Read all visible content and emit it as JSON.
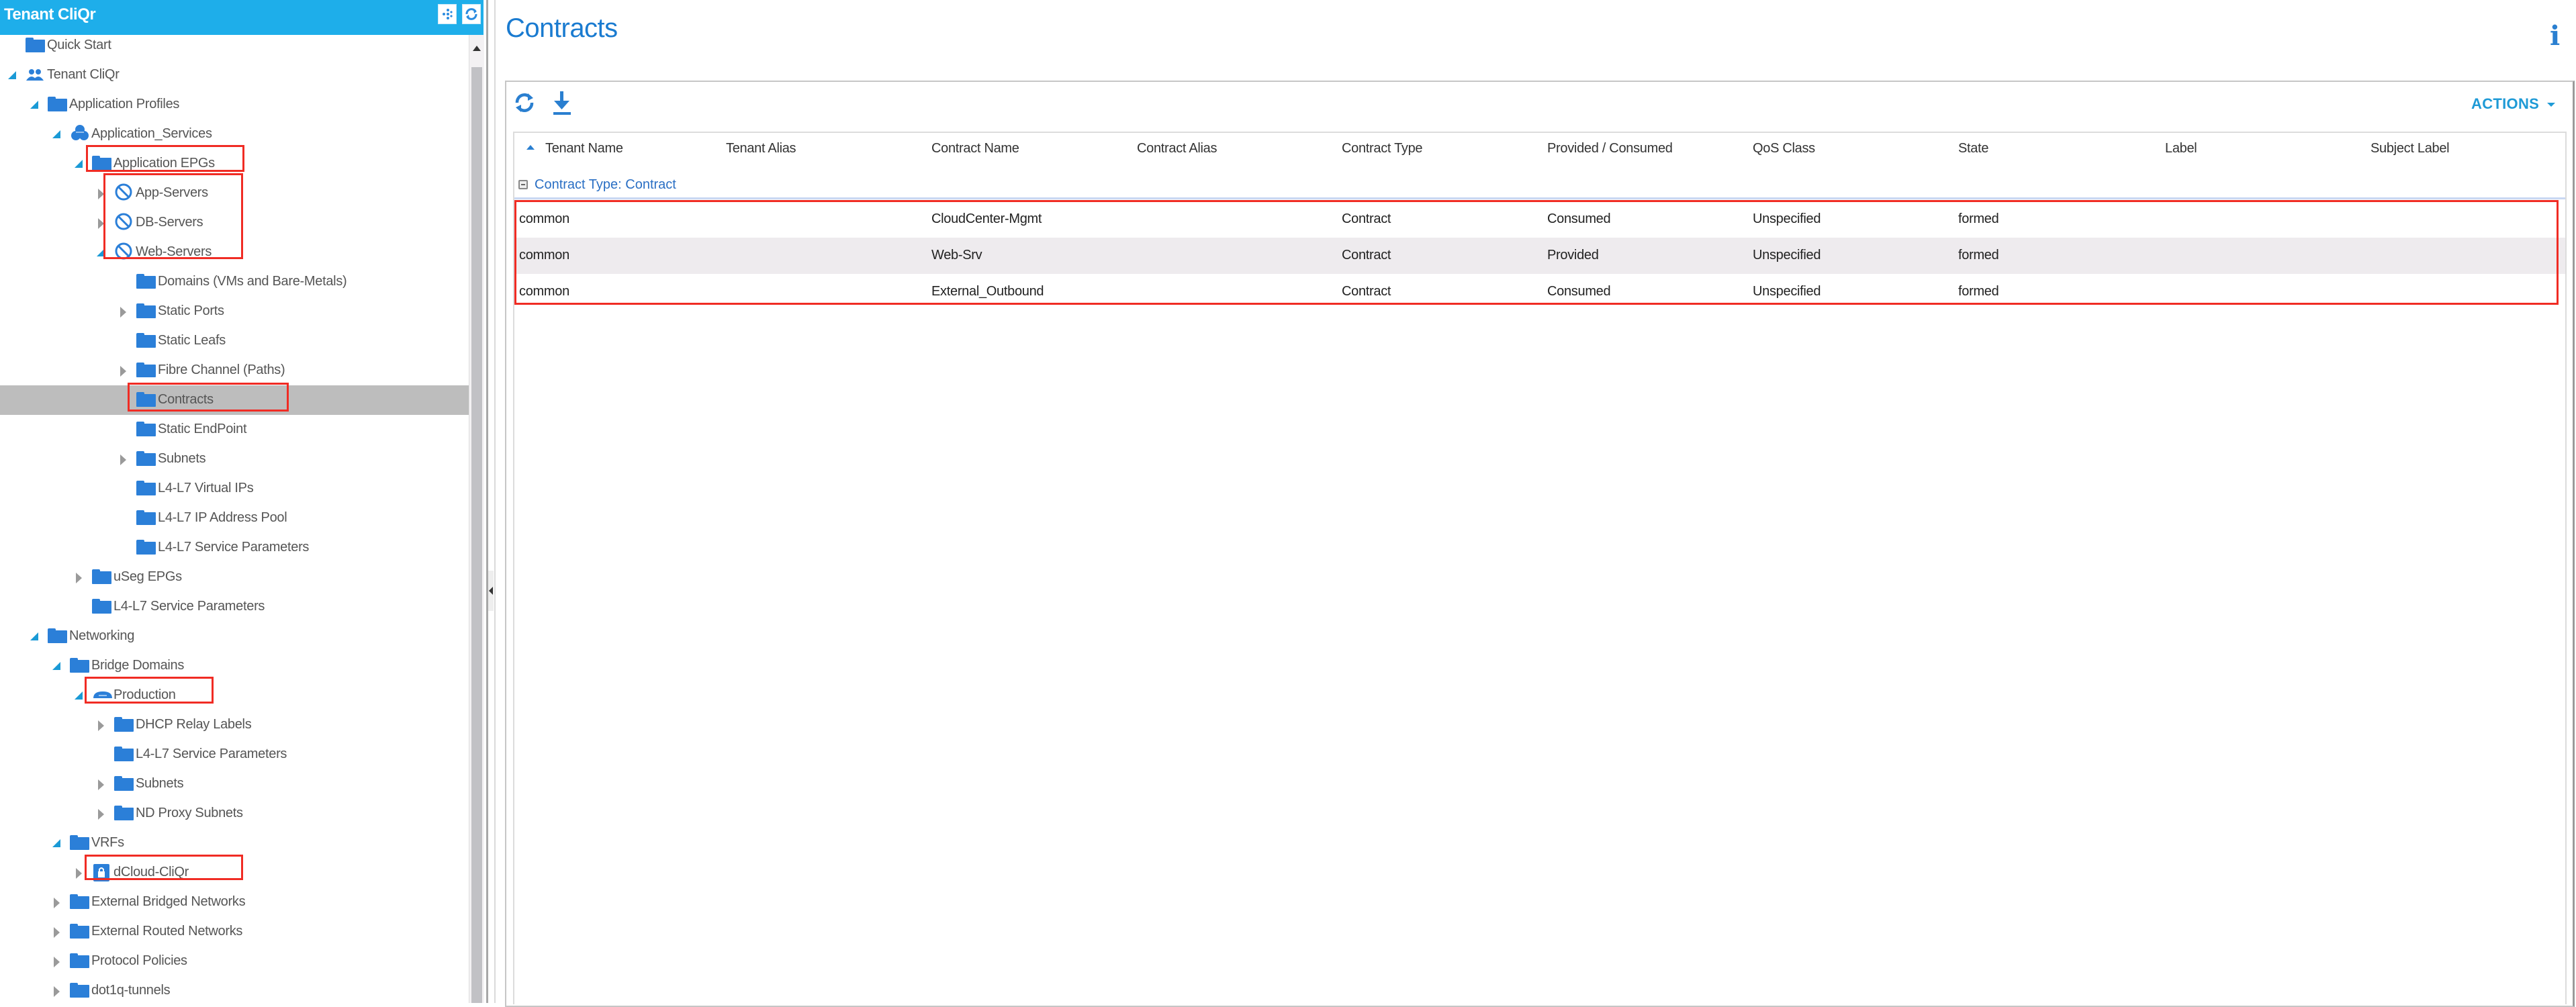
{
  "left_panel": {
    "title": "Tenant CliQr",
    "header_buttons": [
      {
        "name": "topology-icon",
        "glyph": "⁘"
      },
      {
        "name": "refresh-icon",
        "glyph": "⟳"
      }
    ],
    "tree": [
      {
        "label": "Quick Start",
        "level": 0,
        "toggle": "none",
        "icon": "folder-icon"
      },
      {
        "label": "Tenant CliQr",
        "level": 0,
        "toggle": "open",
        "icon": "tenant-icon"
      },
      {
        "label": "Application Profiles",
        "level": 1,
        "toggle": "open",
        "icon": "folder-icon"
      },
      {
        "label": "Application_Services",
        "level": 2,
        "toggle": "open",
        "icon": "app-profile-icon"
      },
      {
        "label": "Application EPGs",
        "level": 3,
        "toggle": "open",
        "icon": "folder-icon",
        "highlight": true
      },
      {
        "label": "App-Servers",
        "level": 4,
        "toggle": "closed",
        "icon": "epg-icon"
      },
      {
        "label": "DB-Servers",
        "level": 4,
        "toggle": "closed",
        "icon": "epg-icon"
      },
      {
        "label": "Web-Servers",
        "level": 4,
        "toggle": "open",
        "icon": "epg-icon"
      },
      {
        "label": "Domains (VMs and Bare-Metals)",
        "level": 5,
        "toggle": "none",
        "icon": "folder-icon"
      },
      {
        "label": "Static Ports",
        "level": 5,
        "toggle": "closed",
        "icon": "folder-icon"
      },
      {
        "label": "Static Leafs",
        "level": 5,
        "toggle": "none",
        "icon": "folder-icon"
      },
      {
        "label": "Fibre Channel (Paths)",
        "level": 5,
        "toggle": "closed",
        "icon": "folder-icon"
      },
      {
        "label": "Contracts",
        "level": 5,
        "toggle": "none",
        "icon": "folder-icon",
        "selected": true,
        "highlight": true
      },
      {
        "label": "Static EndPoint",
        "level": 5,
        "toggle": "none",
        "icon": "folder-icon"
      },
      {
        "label": "Subnets",
        "level": 5,
        "toggle": "closed",
        "icon": "folder-icon"
      },
      {
        "label": "L4-L7 Virtual IPs",
        "level": 5,
        "toggle": "none",
        "icon": "folder-icon"
      },
      {
        "label": "L4-L7 IP Address Pool",
        "level": 5,
        "toggle": "none",
        "icon": "folder-icon"
      },
      {
        "label": "L4-L7 Service Parameters",
        "level": 5,
        "toggle": "none",
        "icon": "folder-icon"
      },
      {
        "label": "uSeg EPGs",
        "level": 3,
        "toggle": "closed",
        "icon": "folder-icon"
      },
      {
        "label": "L4-L7 Service Parameters",
        "level": 3,
        "toggle": "none",
        "icon": "folder-icon"
      },
      {
        "label": "Networking",
        "level": 1,
        "toggle": "open",
        "icon": "folder-icon"
      },
      {
        "label": "Bridge Domains",
        "level": 2,
        "toggle": "open",
        "icon": "folder-icon"
      },
      {
        "label": "Production",
        "level": 3,
        "toggle": "open",
        "icon": "bridge-domain-icon",
        "highlight": true
      },
      {
        "label": "DHCP Relay Labels",
        "level": 4,
        "toggle": "closed",
        "icon": "folder-icon"
      },
      {
        "label": "L4-L7 Service Parameters",
        "level": 4,
        "toggle": "none",
        "icon": "folder-icon"
      },
      {
        "label": "Subnets",
        "level": 4,
        "toggle": "closed",
        "icon": "folder-icon"
      },
      {
        "label": "ND Proxy Subnets",
        "level": 4,
        "toggle": "closed",
        "icon": "folder-icon"
      },
      {
        "label": "VRFs",
        "level": 2,
        "toggle": "open",
        "icon": "folder-icon"
      },
      {
        "label": "dCloud-CliQr",
        "level": 3,
        "toggle": "closed",
        "icon": "vrf-icon",
        "highlight": true
      },
      {
        "label": "External Bridged Networks",
        "level": 2,
        "toggle": "closed",
        "icon": "folder-icon"
      },
      {
        "label": "External Routed Networks",
        "level": 2,
        "toggle": "closed",
        "icon": "folder-icon"
      },
      {
        "label": "Protocol Policies",
        "level": 2,
        "toggle": "closed",
        "icon": "folder-icon"
      },
      {
        "label": "dot1q-tunnels",
        "level": 2,
        "toggle": "closed",
        "icon": "folder-icon"
      }
    ],
    "epg_group_highlight": [
      "App-Servers",
      "DB-Servers",
      "Web-Servers"
    ]
  },
  "main": {
    "title": "Contracts",
    "info_icon": "i",
    "toolbar": {
      "refresh_icon": "refresh-icon",
      "download_icon": "download-icon",
      "actions_label": "ACTIONS"
    },
    "table": {
      "columns": [
        "Tenant Name",
        "Tenant Alias",
        "Contract Name",
        "Contract Alias",
        "Contract Type",
        "Provided / Consumed",
        "QoS Class",
        "State",
        "Label",
        "Subject Label"
      ],
      "sorted_column": "Tenant Name",
      "sort_direction": "ascending",
      "group_label": "Contract Type: Contract",
      "rows": [
        [
          "common",
          "",
          "CloudCenter-Mgmt",
          "",
          "Contract",
          "Consumed",
          "Unspecified",
          "formed",
          "",
          ""
        ],
        [
          "common",
          "",
          "Web-Srv",
          "",
          "Contract",
          "Provided",
          "Unspecified",
          "formed",
          "",
          ""
        ],
        [
          "common",
          "",
          "External_Outbound",
          "",
          "Contract",
          "Consumed",
          "Unspecified",
          "formed",
          "",
          ""
        ]
      ]
    }
  },
  "colors": {
    "header_blue": "#1eaeea",
    "accent_blue": "#1a7bd0",
    "folder_blue": "#2b7fd8",
    "highlight_red": "#f02c24",
    "selected_row": "#bdbdbd",
    "alt_row": "#eeebee"
  }
}
